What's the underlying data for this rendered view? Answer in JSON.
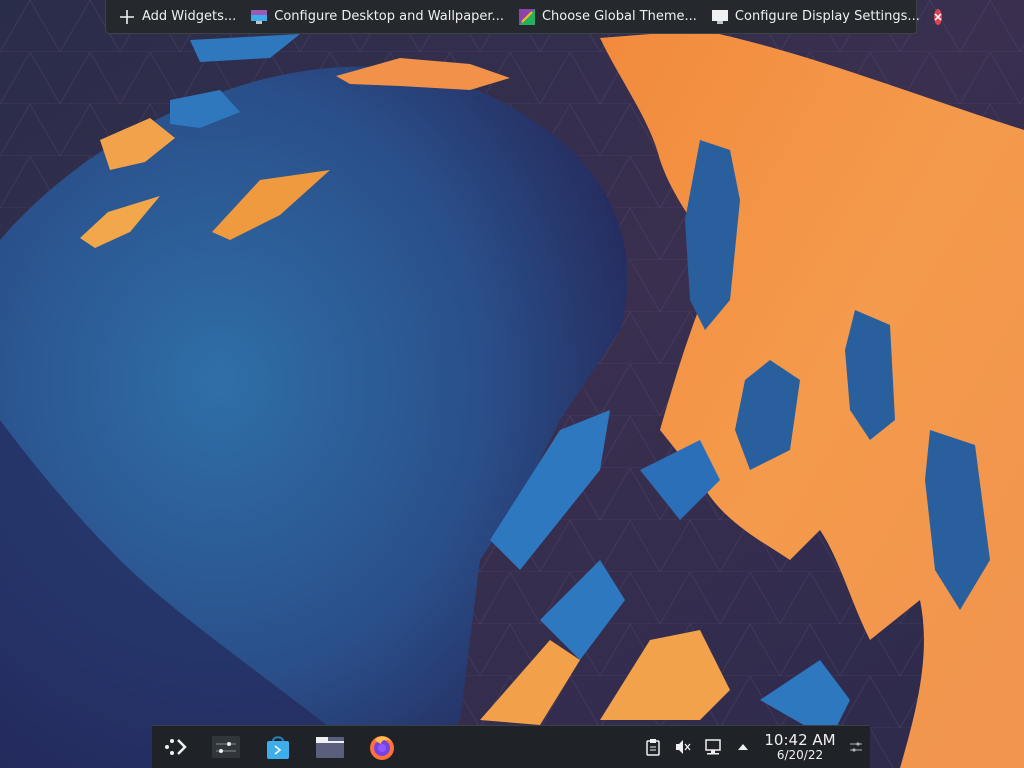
{
  "toolbar": {
    "add_widgets": "Add Widgets...",
    "configure_desktop": "Configure Desktop and Wallpaper...",
    "global_theme": "Choose Global Theme...",
    "display_settings": "Configure Display Settings..."
  },
  "panel": {
    "launcher_icon": "application-launcher-icon",
    "tasks": [
      {
        "name": "system-settings-icon"
      },
      {
        "name": "discover-store-icon"
      },
      {
        "name": "dolphin-file-manager-icon"
      },
      {
        "name": "firefox-icon"
      }
    ],
    "tray_icons": [
      "clipboard-icon",
      "volume-muted-icon",
      "network-icon",
      "show-hidden-icons-arrow"
    ],
    "clock": {
      "time": "10:42 AM",
      "date": "6/20/22"
    }
  },
  "colors": {
    "panel_bg": "#1f2226",
    "toolbar_bg": "#25292e",
    "close": "#da4453",
    "wallpaper_orange": "#f39a45",
    "wallpaper_blue": "#2a74b6"
  }
}
